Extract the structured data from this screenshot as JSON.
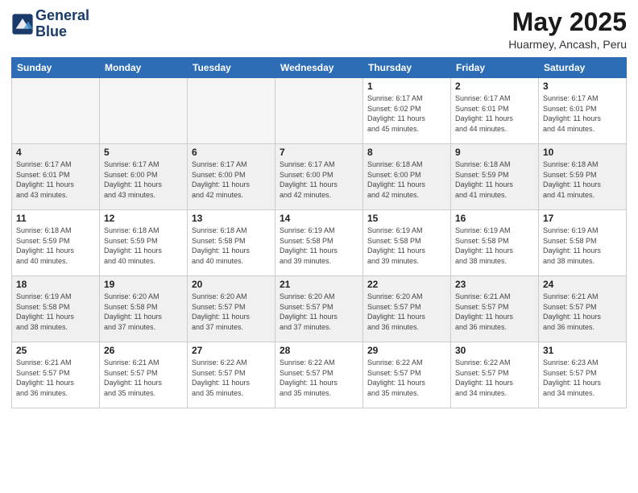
{
  "logo": {
    "line1": "General",
    "line2": "Blue"
  },
  "title": "May 2025",
  "subtitle": "Huarmey, Ancash, Peru",
  "weekdays": [
    "Sunday",
    "Monday",
    "Tuesday",
    "Wednesday",
    "Thursday",
    "Friday",
    "Saturday"
  ],
  "weeks": [
    [
      {
        "day": "",
        "info": ""
      },
      {
        "day": "",
        "info": ""
      },
      {
        "day": "",
        "info": ""
      },
      {
        "day": "",
        "info": ""
      },
      {
        "day": "1",
        "info": "Sunrise: 6:17 AM\nSunset: 6:02 PM\nDaylight: 11 hours\nand 45 minutes."
      },
      {
        "day": "2",
        "info": "Sunrise: 6:17 AM\nSunset: 6:01 PM\nDaylight: 11 hours\nand 44 minutes."
      },
      {
        "day": "3",
        "info": "Sunrise: 6:17 AM\nSunset: 6:01 PM\nDaylight: 11 hours\nand 44 minutes."
      }
    ],
    [
      {
        "day": "4",
        "info": "Sunrise: 6:17 AM\nSunset: 6:01 PM\nDaylight: 11 hours\nand 43 minutes."
      },
      {
        "day": "5",
        "info": "Sunrise: 6:17 AM\nSunset: 6:00 PM\nDaylight: 11 hours\nand 43 minutes."
      },
      {
        "day": "6",
        "info": "Sunrise: 6:17 AM\nSunset: 6:00 PM\nDaylight: 11 hours\nand 42 minutes."
      },
      {
        "day": "7",
        "info": "Sunrise: 6:17 AM\nSunset: 6:00 PM\nDaylight: 11 hours\nand 42 minutes."
      },
      {
        "day": "8",
        "info": "Sunrise: 6:18 AM\nSunset: 6:00 PM\nDaylight: 11 hours\nand 42 minutes."
      },
      {
        "day": "9",
        "info": "Sunrise: 6:18 AM\nSunset: 5:59 PM\nDaylight: 11 hours\nand 41 minutes."
      },
      {
        "day": "10",
        "info": "Sunrise: 6:18 AM\nSunset: 5:59 PM\nDaylight: 11 hours\nand 41 minutes."
      }
    ],
    [
      {
        "day": "11",
        "info": "Sunrise: 6:18 AM\nSunset: 5:59 PM\nDaylight: 11 hours\nand 40 minutes."
      },
      {
        "day": "12",
        "info": "Sunrise: 6:18 AM\nSunset: 5:59 PM\nDaylight: 11 hours\nand 40 minutes."
      },
      {
        "day": "13",
        "info": "Sunrise: 6:18 AM\nSunset: 5:58 PM\nDaylight: 11 hours\nand 40 minutes."
      },
      {
        "day": "14",
        "info": "Sunrise: 6:19 AM\nSunset: 5:58 PM\nDaylight: 11 hours\nand 39 minutes."
      },
      {
        "day": "15",
        "info": "Sunrise: 6:19 AM\nSunset: 5:58 PM\nDaylight: 11 hours\nand 39 minutes."
      },
      {
        "day": "16",
        "info": "Sunrise: 6:19 AM\nSunset: 5:58 PM\nDaylight: 11 hours\nand 38 minutes."
      },
      {
        "day": "17",
        "info": "Sunrise: 6:19 AM\nSunset: 5:58 PM\nDaylight: 11 hours\nand 38 minutes."
      }
    ],
    [
      {
        "day": "18",
        "info": "Sunrise: 6:19 AM\nSunset: 5:58 PM\nDaylight: 11 hours\nand 38 minutes."
      },
      {
        "day": "19",
        "info": "Sunrise: 6:20 AM\nSunset: 5:58 PM\nDaylight: 11 hours\nand 37 minutes."
      },
      {
        "day": "20",
        "info": "Sunrise: 6:20 AM\nSunset: 5:57 PM\nDaylight: 11 hours\nand 37 minutes."
      },
      {
        "day": "21",
        "info": "Sunrise: 6:20 AM\nSunset: 5:57 PM\nDaylight: 11 hours\nand 37 minutes."
      },
      {
        "day": "22",
        "info": "Sunrise: 6:20 AM\nSunset: 5:57 PM\nDaylight: 11 hours\nand 36 minutes."
      },
      {
        "day": "23",
        "info": "Sunrise: 6:21 AM\nSunset: 5:57 PM\nDaylight: 11 hours\nand 36 minutes."
      },
      {
        "day": "24",
        "info": "Sunrise: 6:21 AM\nSunset: 5:57 PM\nDaylight: 11 hours\nand 36 minutes."
      }
    ],
    [
      {
        "day": "25",
        "info": "Sunrise: 6:21 AM\nSunset: 5:57 PM\nDaylight: 11 hours\nand 36 minutes."
      },
      {
        "day": "26",
        "info": "Sunrise: 6:21 AM\nSunset: 5:57 PM\nDaylight: 11 hours\nand 35 minutes."
      },
      {
        "day": "27",
        "info": "Sunrise: 6:22 AM\nSunset: 5:57 PM\nDaylight: 11 hours\nand 35 minutes."
      },
      {
        "day": "28",
        "info": "Sunrise: 6:22 AM\nSunset: 5:57 PM\nDaylight: 11 hours\nand 35 minutes."
      },
      {
        "day": "29",
        "info": "Sunrise: 6:22 AM\nSunset: 5:57 PM\nDaylight: 11 hours\nand 35 minutes."
      },
      {
        "day": "30",
        "info": "Sunrise: 6:22 AM\nSunset: 5:57 PM\nDaylight: 11 hours\nand 34 minutes."
      },
      {
        "day": "31",
        "info": "Sunrise: 6:23 AM\nSunset: 5:57 PM\nDaylight: 11 hours\nand 34 minutes."
      }
    ]
  ]
}
